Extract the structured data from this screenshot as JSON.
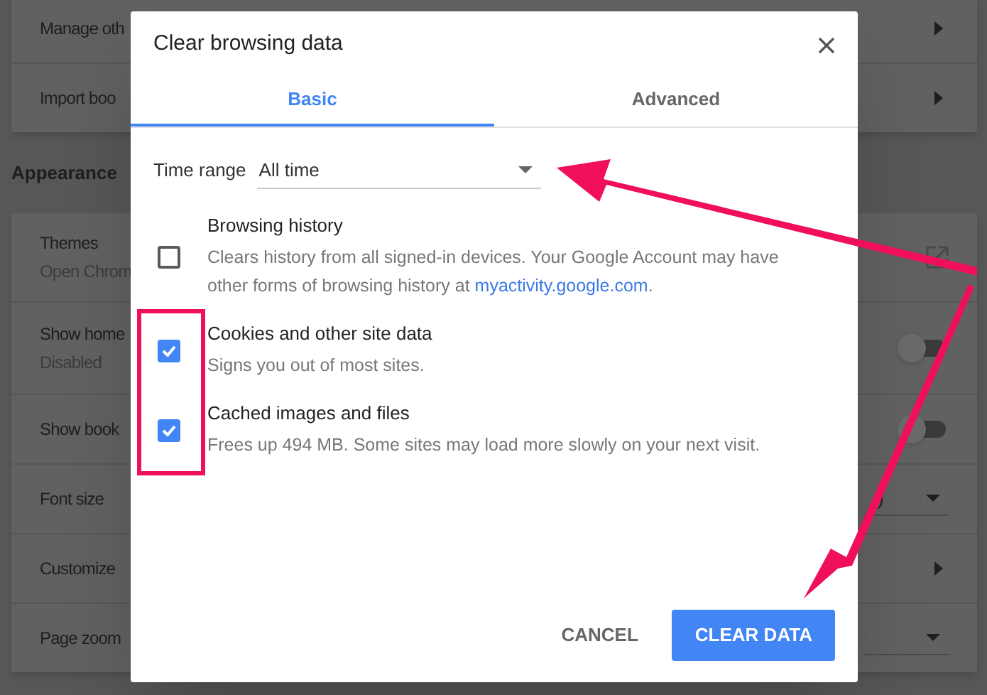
{
  "settings": {
    "top_rows": [
      {
        "label": "Manage oth",
        "control": {
          "kind": "arrow"
        }
      },
      {
        "label": "Import boo",
        "control": {
          "kind": "arrow"
        }
      }
    ],
    "section_title": "Appearance",
    "rows": [
      {
        "label": "Themes",
        "sublabel": "Open Chrom",
        "control": {
          "kind": "external"
        }
      },
      {
        "label": "Show home",
        "sublabel": "Disabled",
        "control": {
          "kind": "toggle",
          "on": false
        }
      },
      {
        "label": "Show book",
        "control": {
          "kind": "toggle",
          "on": false
        }
      },
      {
        "label": "Font size",
        "control": {
          "kind": "dropdown",
          "value": ")"
        }
      },
      {
        "label": "Customize",
        "control": {
          "kind": "arrow"
        }
      },
      {
        "label": "Page zoom",
        "control": {
          "kind": "dropdown"
        }
      }
    ]
  },
  "dialog": {
    "title": "Clear browsing data",
    "tabs": [
      {
        "label": "Basic",
        "selected": true
      },
      {
        "label": "Advanced",
        "selected": false
      }
    ],
    "time_range": {
      "label": "Time range",
      "value": "All time"
    },
    "items": [
      {
        "title": "Browsing history",
        "description": "Clears history from all signed-in devices. Your Google Account may have other forms of browsing history at ",
        "link": "myactivity.google.com",
        "description_end": ".",
        "checked": false
      },
      {
        "title": "Cookies and other site data",
        "description": "Signs you out of most sites.",
        "checked": true
      },
      {
        "title": "Cached images and files",
        "description": "Frees up 494 MB. Some sites may load more slowly on your next visit.",
        "checked": true
      }
    ],
    "buttons": [
      {
        "label": "CANCEL",
        "kind": "text"
      },
      {
        "label": "CLEAR DATA",
        "kind": "primary"
      }
    ]
  }
}
